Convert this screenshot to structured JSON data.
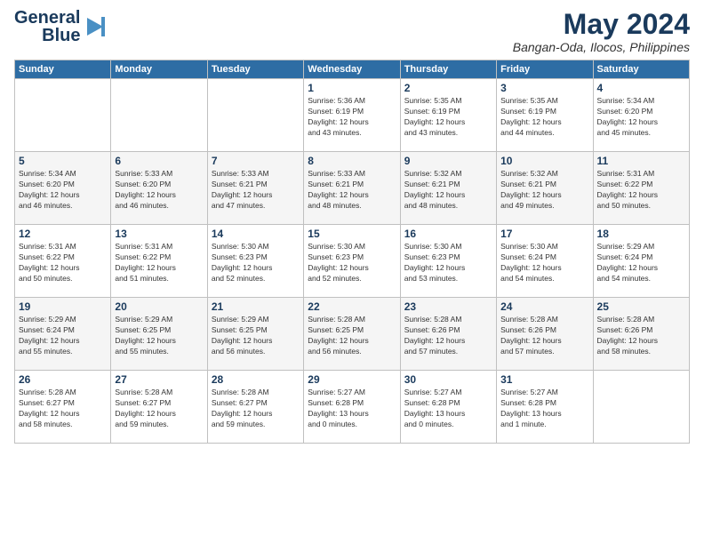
{
  "logo": {
    "line1": "General",
    "line2": "Blue",
    "icon": "▶"
  },
  "header": {
    "month": "May 2024",
    "location": "Bangan-Oda, Ilocos, Philippines"
  },
  "weekdays": [
    "Sunday",
    "Monday",
    "Tuesday",
    "Wednesday",
    "Thursday",
    "Friday",
    "Saturday"
  ],
  "weeks": [
    [
      {
        "day": "",
        "info": ""
      },
      {
        "day": "",
        "info": ""
      },
      {
        "day": "",
        "info": ""
      },
      {
        "day": "1",
        "info": "Sunrise: 5:36 AM\nSunset: 6:19 PM\nDaylight: 12 hours\nand 43 minutes."
      },
      {
        "day": "2",
        "info": "Sunrise: 5:35 AM\nSunset: 6:19 PM\nDaylight: 12 hours\nand 43 minutes."
      },
      {
        "day": "3",
        "info": "Sunrise: 5:35 AM\nSunset: 6:19 PM\nDaylight: 12 hours\nand 44 minutes."
      },
      {
        "day": "4",
        "info": "Sunrise: 5:34 AM\nSunset: 6:20 PM\nDaylight: 12 hours\nand 45 minutes."
      }
    ],
    [
      {
        "day": "5",
        "info": "Sunrise: 5:34 AM\nSunset: 6:20 PM\nDaylight: 12 hours\nand 46 minutes."
      },
      {
        "day": "6",
        "info": "Sunrise: 5:33 AM\nSunset: 6:20 PM\nDaylight: 12 hours\nand 46 minutes."
      },
      {
        "day": "7",
        "info": "Sunrise: 5:33 AM\nSunset: 6:21 PM\nDaylight: 12 hours\nand 47 minutes."
      },
      {
        "day": "8",
        "info": "Sunrise: 5:33 AM\nSunset: 6:21 PM\nDaylight: 12 hours\nand 48 minutes."
      },
      {
        "day": "9",
        "info": "Sunrise: 5:32 AM\nSunset: 6:21 PM\nDaylight: 12 hours\nand 48 minutes."
      },
      {
        "day": "10",
        "info": "Sunrise: 5:32 AM\nSunset: 6:21 PM\nDaylight: 12 hours\nand 49 minutes."
      },
      {
        "day": "11",
        "info": "Sunrise: 5:31 AM\nSunset: 6:22 PM\nDaylight: 12 hours\nand 50 minutes."
      }
    ],
    [
      {
        "day": "12",
        "info": "Sunrise: 5:31 AM\nSunset: 6:22 PM\nDaylight: 12 hours\nand 50 minutes."
      },
      {
        "day": "13",
        "info": "Sunrise: 5:31 AM\nSunset: 6:22 PM\nDaylight: 12 hours\nand 51 minutes."
      },
      {
        "day": "14",
        "info": "Sunrise: 5:30 AM\nSunset: 6:23 PM\nDaylight: 12 hours\nand 52 minutes."
      },
      {
        "day": "15",
        "info": "Sunrise: 5:30 AM\nSunset: 6:23 PM\nDaylight: 12 hours\nand 52 minutes."
      },
      {
        "day": "16",
        "info": "Sunrise: 5:30 AM\nSunset: 6:23 PM\nDaylight: 12 hours\nand 53 minutes."
      },
      {
        "day": "17",
        "info": "Sunrise: 5:30 AM\nSunset: 6:24 PM\nDaylight: 12 hours\nand 54 minutes."
      },
      {
        "day": "18",
        "info": "Sunrise: 5:29 AM\nSunset: 6:24 PM\nDaylight: 12 hours\nand 54 minutes."
      }
    ],
    [
      {
        "day": "19",
        "info": "Sunrise: 5:29 AM\nSunset: 6:24 PM\nDaylight: 12 hours\nand 55 minutes."
      },
      {
        "day": "20",
        "info": "Sunrise: 5:29 AM\nSunset: 6:25 PM\nDaylight: 12 hours\nand 55 minutes."
      },
      {
        "day": "21",
        "info": "Sunrise: 5:29 AM\nSunset: 6:25 PM\nDaylight: 12 hours\nand 56 minutes."
      },
      {
        "day": "22",
        "info": "Sunrise: 5:28 AM\nSunset: 6:25 PM\nDaylight: 12 hours\nand 56 minutes."
      },
      {
        "day": "23",
        "info": "Sunrise: 5:28 AM\nSunset: 6:26 PM\nDaylight: 12 hours\nand 57 minutes."
      },
      {
        "day": "24",
        "info": "Sunrise: 5:28 AM\nSunset: 6:26 PM\nDaylight: 12 hours\nand 57 minutes."
      },
      {
        "day": "25",
        "info": "Sunrise: 5:28 AM\nSunset: 6:26 PM\nDaylight: 12 hours\nand 58 minutes."
      }
    ],
    [
      {
        "day": "26",
        "info": "Sunrise: 5:28 AM\nSunset: 6:27 PM\nDaylight: 12 hours\nand 58 minutes."
      },
      {
        "day": "27",
        "info": "Sunrise: 5:28 AM\nSunset: 6:27 PM\nDaylight: 12 hours\nand 59 minutes."
      },
      {
        "day": "28",
        "info": "Sunrise: 5:28 AM\nSunset: 6:27 PM\nDaylight: 12 hours\nand 59 minutes."
      },
      {
        "day": "29",
        "info": "Sunrise: 5:27 AM\nSunset: 6:28 PM\nDaylight: 13 hours\nand 0 minutes."
      },
      {
        "day": "30",
        "info": "Sunrise: 5:27 AM\nSunset: 6:28 PM\nDaylight: 13 hours\nand 0 minutes."
      },
      {
        "day": "31",
        "info": "Sunrise: 5:27 AM\nSunset: 6:28 PM\nDaylight: 13 hours\nand 1 minute."
      },
      {
        "day": "",
        "info": ""
      }
    ]
  ]
}
